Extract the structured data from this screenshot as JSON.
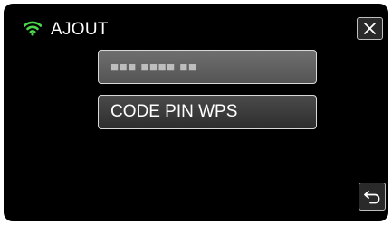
{
  "header": {
    "title": "AJOUT",
    "wifi_icon": "wifi-icon",
    "wifi_color": "#4cd64c",
    "close_icon": "close-icon"
  },
  "list": {
    "items": [
      {
        "label": "■■■ ■■■■ ■■",
        "masked": true
      },
      {
        "label": "CODE PIN WPS",
        "masked": false
      }
    ]
  },
  "footer": {
    "back_icon": "return-icon"
  }
}
